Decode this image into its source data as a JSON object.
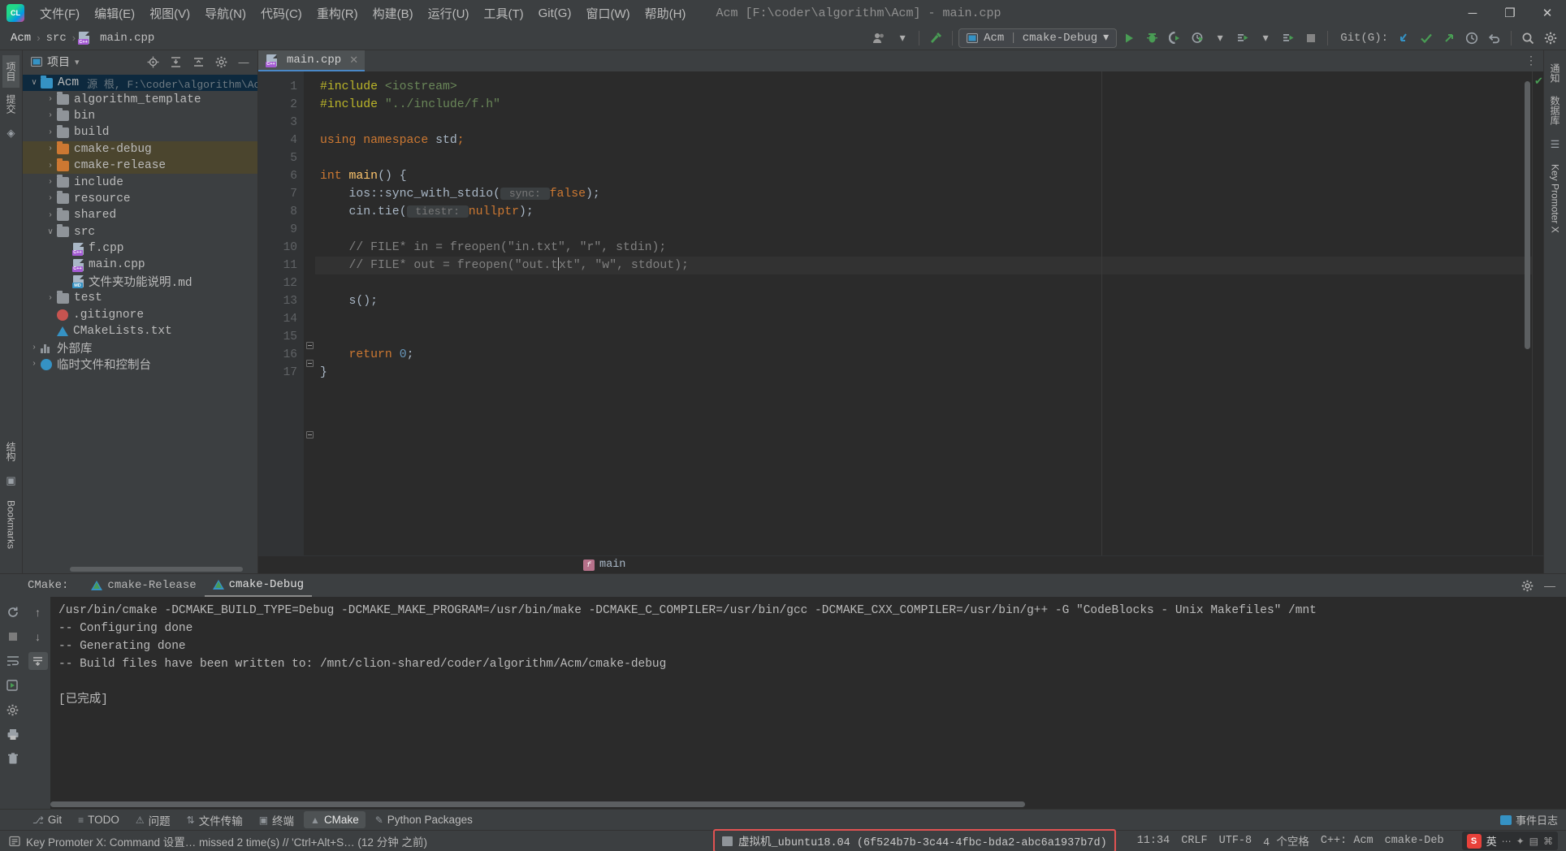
{
  "window": {
    "title": "Acm [F:\\coder\\algorithm\\Acm] - main.cpp",
    "minimize": "─",
    "maximize": "❐",
    "close": "✕"
  },
  "menu": {
    "items": [
      {
        "label": "文件(F)",
        "name": "menu-file"
      },
      {
        "label": "编辑(E)",
        "name": "menu-edit"
      },
      {
        "label": "视图(V)",
        "name": "menu-view"
      },
      {
        "label": "导航(N)",
        "name": "menu-navigate"
      },
      {
        "label": "代码(C)",
        "name": "menu-code"
      },
      {
        "label": "重构(R)",
        "name": "menu-refactor"
      },
      {
        "label": "构建(B)",
        "name": "menu-build"
      },
      {
        "label": "运行(U)",
        "name": "menu-run"
      },
      {
        "label": "工具(T)",
        "name": "menu-tools"
      },
      {
        "label": "Git(G)",
        "name": "menu-git"
      },
      {
        "label": "窗口(W)",
        "name": "menu-window"
      },
      {
        "label": "帮助(H)",
        "name": "menu-help"
      }
    ]
  },
  "toolbar": {
    "breadcrumb": [
      "Acm",
      "src",
      "main.cpp"
    ],
    "breadcrumb_sep": "›",
    "run_config": {
      "project": "Acm",
      "separator": "|",
      "config": "cmake-Debug",
      "dropdown": "▾"
    },
    "git_label": "Git(G):",
    "icons": {
      "vcs_user": "♟",
      "hammer": "hammer-build",
      "run": "▶",
      "debug": "bug",
      "run_coverage": "coverage",
      "profile": "profiler",
      "dropdown": "▾",
      "attach": "attach-process",
      "stop": "■",
      "update": "↙",
      "commit": "✔",
      "push": "↗",
      "history": "◷",
      "rollback": "↶",
      "search": "⌕",
      "settings": "⚙",
      "menu_more": "⋮"
    }
  },
  "left_rail": {
    "tabs": [
      "项目",
      "提交",
      "结构",
      "Bookmarks"
    ],
    "active": "项目"
  },
  "right_rail": {
    "tabs": [
      "通知",
      "数据库",
      "Key Promoter X"
    ]
  },
  "project_panel": {
    "title": "项目",
    "dropdown": "▾",
    "header_icons": [
      "locate-icon",
      "expand-all-icon",
      "collapse-all-icon",
      "settings-icon",
      "hide-icon"
    ],
    "tree": [
      {
        "indent": 0,
        "twist": "∨",
        "icon": "folder-blue",
        "label": "Acm",
        "info": "源 根, F:\\coder\\algorithm\\Ac",
        "selected": true
      },
      {
        "indent": 1,
        "twist": "›",
        "icon": "folder",
        "label": "algorithm_template",
        "info": ""
      },
      {
        "indent": 1,
        "twist": "›",
        "icon": "folder",
        "label": "bin",
        "info": ""
      },
      {
        "indent": 1,
        "twist": "›",
        "icon": "folder",
        "label": "build",
        "info": ""
      },
      {
        "indent": 1,
        "twist": "›",
        "icon": "folder-orange",
        "label": "cmake-debug",
        "info": "",
        "highlight": true
      },
      {
        "indent": 1,
        "twist": "›",
        "icon": "folder-orange",
        "label": "cmake-release",
        "info": "",
        "highlight": true
      },
      {
        "indent": 1,
        "twist": "›",
        "icon": "folder",
        "label": "include",
        "info": ""
      },
      {
        "indent": 1,
        "twist": "›",
        "icon": "folder",
        "label": "resource",
        "info": ""
      },
      {
        "indent": 1,
        "twist": "›",
        "icon": "folder",
        "label": "shared",
        "info": ""
      },
      {
        "indent": 1,
        "twist": "∨",
        "icon": "folder",
        "label": "src",
        "info": ""
      },
      {
        "indent": 2,
        "twist": "",
        "icon": "file-cpp",
        "label": "f.cpp",
        "info": ""
      },
      {
        "indent": 2,
        "twist": "",
        "icon": "file-cpp",
        "label": "main.cpp",
        "info": ""
      },
      {
        "indent": 2,
        "twist": "",
        "icon": "file-md",
        "label": "文件夹功能说明.md",
        "info": ""
      },
      {
        "indent": 1,
        "twist": "›",
        "icon": "folder",
        "label": "test",
        "info": ""
      },
      {
        "indent": 1,
        "twist": "",
        "icon": "file-git",
        "label": ".gitignore",
        "info": ""
      },
      {
        "indent": 1,
        "twist": "",
        "icon": "file-cmake",
        "label": "CMakeLists.txt",
        "info": ""
      },
      {
        "indent": 0,
        "twist": "›",
        "icon": "library",
        "label": "外部库",
        "info": ""
      },
      {
        "indent": 0,
        "twist": "›",
        "icon": "scratch",
        "label": "临时文件和控制台",
        "info": ""
      }
    ]
  },
  "editor": {
    "tab": {
      "label": "main.cpp",
      "close": "✕",
      "icon": "file-cpp"
    },
    "more": "⋮",
    "inspection_ok": "✔",
    "lines": [
      {
        "n": 1,
        "fold": "open",
        "tokens": [
          {
            "t": "#include ",
            "c": "pre"
          },
          {
            "t": "<iostream>",
            "c": "str"
          }
        ]
      },
      {
        "n": 2,
        "fold": "close",
        "tokens": [
          {
            "t": "#include ",
            "c": "pre"
          },
          {
            "t": "\"../include/f.h\"",
            "c": "str"
          }
        ]
      },
      {
        "n": 3,
        "fold": "",
        "tokens": []
      },
      {
        "n": 4,
        "fold": "",
        "tokens": [
          {
            "t": "using namespace ",
            "c": "kw"
          },
          {
            "t": "std",
            "c": "ident"
          },
          {
            "t": ";",
            "c": "kw"
          }
        ]
      },
      {
        "n": 5,
        "fold": "",
        "tokens": []
      },
      {
        "n": 6,
        "fold": "open",
        "run": true,
        "tokens": [
          {
            "t": "int ",
            "c": "kw"
          },
          {
            "t": "main",
            "c": "fn"
          },
          {
            "t": "() {",
            "c": "ident"
          }
        ]
      },
      {
        "n": 7,
        "fold": "",
        "tokens": [
          {
            "t": "    ios::",
            "c": "ident"
          },
          {
            "t": "sync_with_stdio",
            "c": "ident"
          },
          {
            "t": "(",
            "c": "ident"
          },
          {
            "t": " sync: ",
            "c": "hint"
          },
          {
            "t": "false",
            "c": "kw"
          },
          {
            "t": ");",
            "c": "ident"
          }
        ]
      },
      {
        "n": 8,
        "fold": "",
        "tokens": [
          {
            "t": "    cin.",
            "c": "ident"
          },
          {
            "t": "tie",
            "c": "ident"
          },
          {
            "t": "(",
            "c": "ident"
          },
          {
            "t": " tiestr: ",
            "c": "hint"
          },
          {
            "t": "nullptr",
            "c": "kw"
          },
          {
            "t": ");",
            "c": "ident"
          }
        ]
      },
      {
        "n": 9,
        "fold": "",
        "tokens": []
      },
      {
        "n": 10,
        "fold": "",
        "tokens": [
          {
            "t": "    // FILE* in = freopen(\"in.txt\", \"r\", stdin);",
            "c": "cmt"
          }
        ]
      },
      {
        "n": 11,
        "fold": "",
        "highlight": true,
        "caret_after": 21,
        "tokens": [
          {
            "t": "    // FILE* out = freopen(\"out.t",
            "c": "cmt"
          },
          {
            "t": "xt\", \"w\", stdout);",
            "c": "cmt"
          }
        ]
      },
      {
        "n": 12,
        "fold": "",
        "tokens": []
      },
      {
        "n": 13,
        "fold": "",
        "tokens": [
          {
            "t": "    s();",
            "c": "ident"
          }
        ]
      },
      {
        "n": 14,
        "fold": "",
        "tokens": []
      },
      {
        "n": 15,
        "fold": "",
        "tokens": []
      },
      {
        "n": 16,
        "fold": "",
        "tokens": [
          {
            "t": "    ",
            "c": "ident"
          },
          {
            "t": "return ",
            "c": "kw"
          },
          {
            "t": "0",
            "c": "num"
          },
          {
            "t": ";",
            "c": "ident"
          }
        ]
      },
      {
        "n": 17,
        "fold": "close",
        "tokens": [
          {
            "t": "}",
            "c": "ident"
          }
        ]
      }
    ],
    "breadcrumb_fn": "main",
    "breadcrumb_badge": "f"
  },
  "cmake_panel": {
    "label": "CMake:",
    "tabs": [
      {
        "label": "cmake-Release",
        "active": false
      },
      {
        "label": "cmake-Debug",
        "active": true
      }
    ],
    "header_icons": [
      "settings-icon",
      "hide-icon"
    ],
    "rail_icons": [
      "rerun-icon",
      "up-icon",
      "stop-icon",
      "down-icon",
      "soft-wrap-icon",
      "run-build-icon",
      "scroll-end-icon",
      "settings-icon",
      "print-icon",
      "trash-icon"
    ],
    "console": [
      "/usr/bin/cmake -DCMAKE_BUILD_TYPE=Debug -DCMAKE_MAKE_PROGRAM=/usr/bin/make -DCMAKE_C_COMPILER=/usr/bin/gcc -DCMAKE_CXX_COMPILER=/usr/bin/g++ -G \"CodeBlocks - Unix Makefiles\" /mnt",
      "-- Configuring done",
      "-- Generating done",
      "-- Build files have been written to: /mnt/clion-shared/coder/algorithm/Acm/cmake-debug",
      "",
      "[已完成]"
    ]
  },
  "tool_tabs": {
    "items": [
      {
        "label": "Git",
        "icon": "git-icon",
        "active": false
      },
      {
        "label": "TODO",
        "icon": "todo-icon",
        "active": false
      },
      {
        "label": "问题",
        "icon": "problems-icon",
        "active": false
      },
      {
        "label": "文件传输",
        "icon": "file-transfer-icon",
        "active": false
      },
      {
        "label": "终端",
        "icon": "terminal-icon",
        "active": false
      },
      {
        "label": "CMake",
        "icon": "cmake-icon",
        "active": true
      },
      {
        "label": "Python Packages",
        "icon": "python-icon",
        "active": false
      }
    ],
    "event_log": {
      "label": "事件日志",
      "icon": "event-log-icon"
    }
  },
  "status_bar": {
    "left_icon": "log-icon",
    "message": "Key Promoter X: Command 设置… missed 2 time(s) // 'Ctrl+Alt+S… (12 分钟 之前)",
    "vm": {
      "icon": "vm-icon",
      "text": "虚拟机_ubuntu18.04 (6f524b7b-3c44-4fbc-bda2-abc6a1937b7d)"
    },
    "position": "11:34",
    "line_sep": "CRLF",
    "encoding": "UTF-8",
    "indent": "4 个空格",
    "lang": "C++: Acm",
    "config": "cmake-Deb",
    "ime": {
      "sogou": "S",
      "mode": "英",
      "icons": [
        "…",
        "✦",
        "⌘",
        "▤",
        "⋯"
      ]
    }
  },
  "colors": {
    "accent_blue": "#4a88c7",
    "green": "#499c54",
    "orange": "#cc7832",
    "red": "#e05252",
    "bg_panel": "#3c3f41",
    "bg_editor": "#2b2b2b"
  }
}
